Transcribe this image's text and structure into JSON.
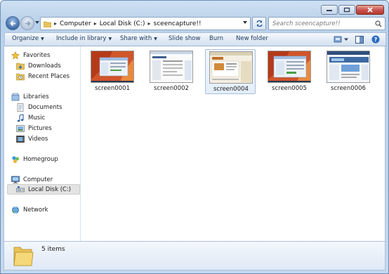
{
  "address": {
    "crumbs": [
      "Computer",
      "Local Disk (C:)",
      "sceencapture!!"
    ]
  },
  "search": {
    "placeholder": "Search sceencapture!!"
  },
  "commands": [
    {
      "label": "Organize",
      "has_menu": true
    },
    {
      "label": "Include in library",
      "has_menu": true
    },
    {
      "label": "Share with",
      "has_menu": true
    },
    {
      "label": "Slide show",
      "has_menu": false
    },
    {
      "label": "Burn",
      "has_menu": false
    },
    {
      "label": "New folder",
      "has_menu": false
    }
  ],
  "nav": {
    "favorites": {
      "label": "Favorites",
      "icon": "star-icon",
      "items": [
        "Downloads",
        "Recent Places"
      ]
    },
    "libraries": {
      "label": "Libraries",
      "icon": "library-icon",
      "items": [
        "Documents",
        "Music",
        "Pictures",
        "Videos"
      ]
    },
    "homegroup": {
      "label": "Homegroup",
      "icon": "homegroup-icon"
    },
    "computer": {
      "label": "Computer",
      "icon": "computer-icon",
      "items": [
        "Local Disk (C:)"
      ],
      "selected": "Local Disk (C:)"
    },
    "network": {
      "label": "Network",
      "icon": "network-icon"
    }
  },
  "files": [
    {
      "name": "screen0001",
      "thumbnail": "orange-desktop-screenshot"
    },
    {
      "name": "screen0002",
      "thumbnail": "white-webpage-screenshot"
    },
    {
      "name": "screen0004",
      "thumbnail": "beige-webpage-screenshot",
      "selected": true
    },
    {
      "name": "screen0005",
      "thumbnail": "orange-desktop-screenshot"
    },
    {
      "name": "screen0006",
      "thumbnail": "blue-webpage-screenshot"
    }
  ],
  "status": {
    "item_count": "5 items"
  },
  "colors": {
    "accent": "#1e395b",
    "selection": "#e4eefa",
    "close": "#c75050"
  }
}
